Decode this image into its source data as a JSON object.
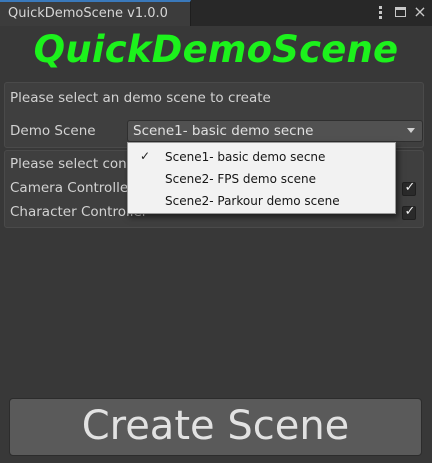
{
  "window": {
    "tab_title": "QuickDemoScene v1.0.0"
  },
  "header": {
    "title": "QuickDemoScene",
    "title_color": "#1cf21c"
  },
  "form": {
    "intro_text": "Please select an demo scene to create",
    "demo_scene_label": "Demo Scene",
    "demo_scene_value": "Scene1- basic demo secne",
    "controllers_text": "Please select con",
    "camera_label": "Camera Controlle",
    "camera_checked": true,
    "character_label": "Character Controller",
    "character_checked": true
  },
  "dropdown_menu": {
    "options": [
      {
        "label": "Scene1- basic demo secne",
        "selected": true
      },
      {
        "label": "Scene2- FPS demo scene",
        "selected": false
      },
      {
        "label": "Scene2- Parkour demo scene",
        "selected": false
      }
    ],
    "check_mark": "✓"
  },
  "footer": {
    "create_button_label": "Create Scene"
  },
  "icons": {
    "checkbox_check": "✓",
    "close": "×"
  }
}
